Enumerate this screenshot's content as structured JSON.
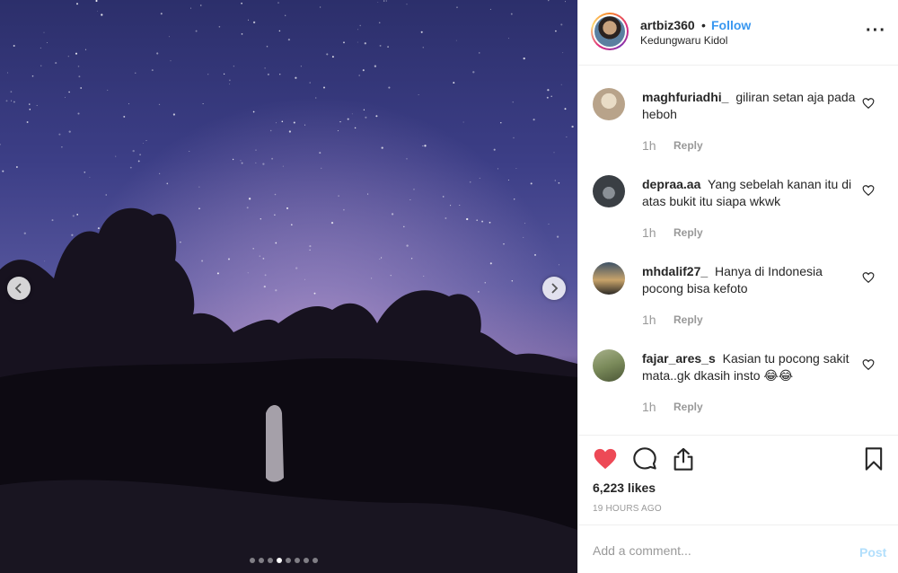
{
  "post": {
    "author": "artbiz360",
    "separator": "•",
    "follow_label": "Follow",
    "location": "Kedungwaru Kidol",
    "more_icon": "more-options-icon"
  },
  "media": {
    "photo_icon": "night-sky-photo",
    "prev_icon": "chevron-left-icon",
    "next_icon": "chevron-right-icon",
    "carousel_count": 8,
    "carousel_active_index": 3
  },
  "comments": [
    {
      "username": "maghfuriadhi_",
      "text": "giliran setan aja pada heboh",
      "time": "1h",
      "reply_label": "Reply",
      "avatar_color": "#b8a38a"
    },
    {
      "username": "depraa.aa",
      "text": "Yang sebelah kanan itu di atas bukit itu siapa wkwk",
      "time": "1h",
      "reply_label": "Reply",
      "avatar_color": "#3a3f44"
    },
    {
      "username": "mhdalif27_",
      "text": "Hanya di Indonesia pocong bisa kefoto",
      "time": "1h",
      "reply_label": "Reply",
      "avatar_color": "#c8a36a"
    },
    {
      "username": "fajar_ares_s",
      "text": "Kasian tu pocong sakit mata..gk dkasih insto 😂😂",
      "time": "1h",
      "reply_label": "Reply",
      "avatar_color": "#7a8a5a"
    }
  ],
  "actions": {
    "like_icon": "heart-filled-icon",
    "comment_icon": "comment-bubble-icon",
    "share_icon": "share-upload-icon",
    "save_icon": "bookmark-icon",
    "like_color": "#ed4956",
    "likes_text": "6,223 likes",
    "time_ago": "19 HOURS AGO"
  },
  "composer": {
    "placeholder": "Add a comment...",
    "post_label": "Post",
    "post_color": "#b2dffc"
  },
  "colors": {
    "link": "#3897f0",
    "muted": "#999999",
    "text": "#262626",
    "border": "#efefef"
  }
}
